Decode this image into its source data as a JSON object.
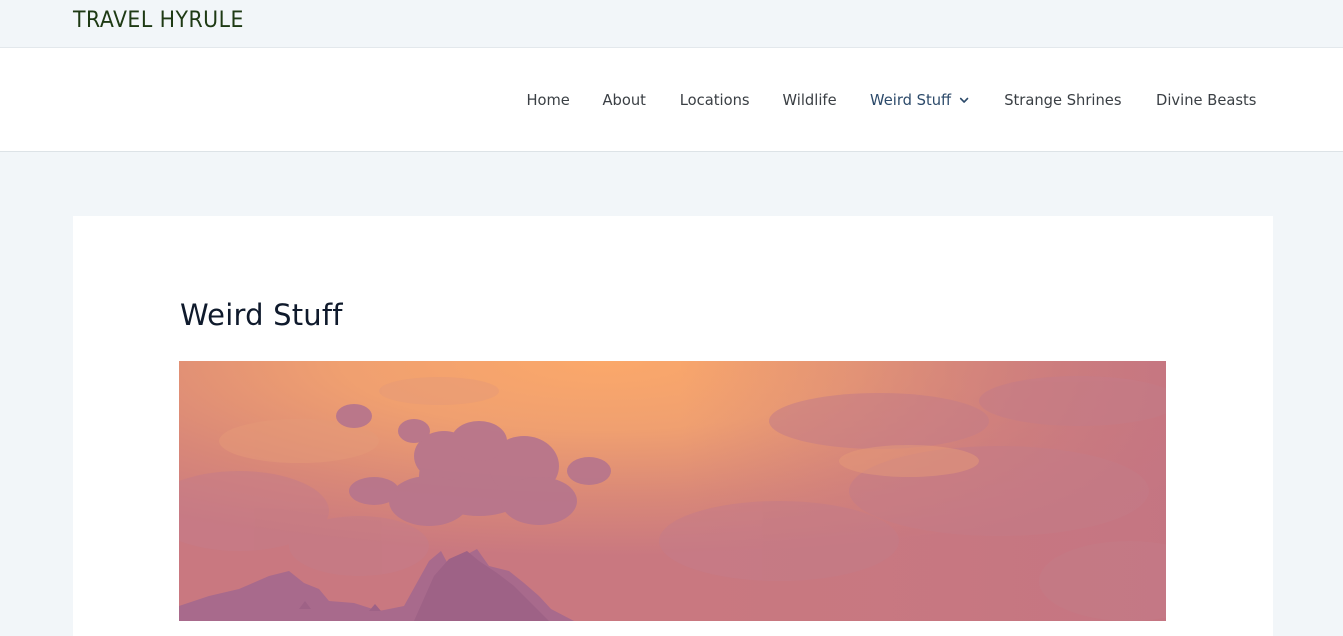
{
  "site": {
    "title": "TRAVEL HYRULE"
  },
  "nav": {
    "items": [
      {
        "label": "Home"
      },
      {
        "label": "About"
      },
      {
        "label": "Locations"
      },
      {
        "label": "Wildlife"
      },
      {
        "label": "Weird Stuff",
        "has_dropdown": true,
        "active": true
      },
      {
        "label": "Strange Shrines"
      },
      {
        "label": "Divine Beasts"
      }
    ]
  },
  "page": {
    "title": "Weird Stuff"
  },
  "colors": {
    "background": "#f2f6f9",
    "title": "#1e3a14",
    "nav_text": "#3a3f44",
    "nav_active": "#2c4a6a",
    "heading": "#0f1a2c"
  },
  "hero": {
    "icon": "sunset-sky-mountain-image"
  }
}
